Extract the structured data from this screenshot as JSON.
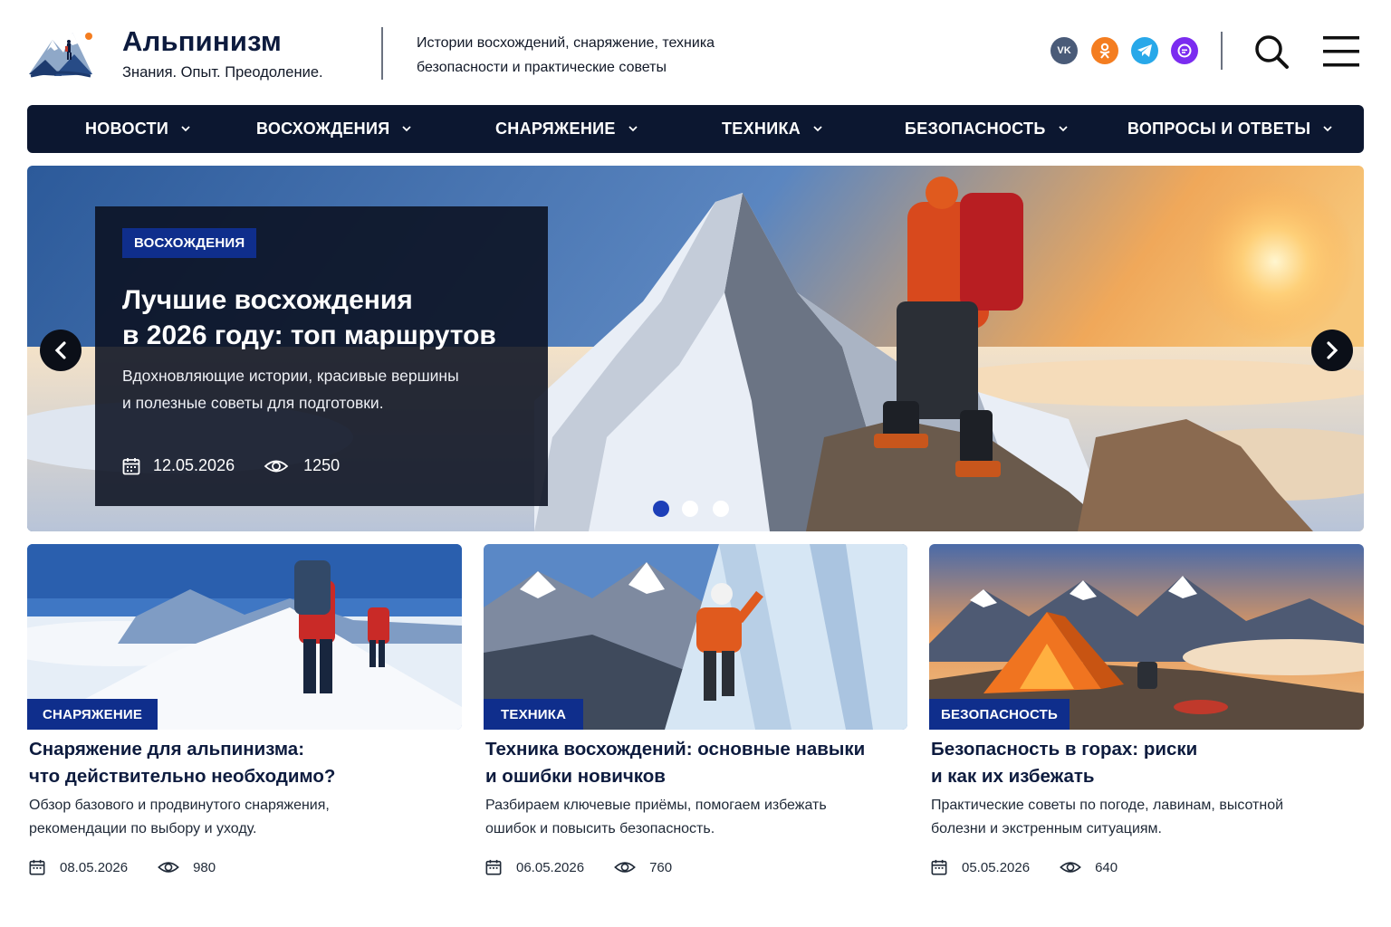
{
  "header": {
    "site_title": "Альпинизм",
    "tagline": "Знания. Опыт. Преодоление.",
    "description_line1": "Истории восхождений, снаряжение, техника",
    "description_line2": "безопасности и практические советы",
    "social": [
      {
        "name": "vk-icon",
        "label": "VK",
        "color": "#4a5b78"
      },
      {
        "name": "odnoklassniki-icon",
        "color": "#f47d20"
      },
      {
        "name": "telegram-icon",
        "color": "#28a8e9"
      },
      {
        "name": "max-messenger-icon",
        "color": "#7b2cf0"
      }
    ],
    "search_icon": "search-icon",
    "menu_icon": "hamburger-menu-icon"
  },
  "nav": {
    "items": [
      {
        "label": "НОВОСТИ"
      },
      {
        "label": "ВОСХОЖДЕНИЯ"
      },
      {
        "label": "СНАРЯЖЕНИЕ"
      },
      {
        "label": "ТЕХНИКА"
      },
      {
        "label": "БЕЗОПАСНОСТЬ"
      },
      {
        "label": "ВОПРОСЫ И ОТВЕТЫ"
      }
    ],
    "dropdown_icon": "chevron-down-icon"
  },
  "hero": {
    "badge": "ВОСХОЖДЕНИЯ",
    "title_line1": "Лучшие восхождения",
    "title_line2": "в 2026 году: топ маршрутов",
    "text_line1": "Вдохновляющие истории, красивые вершины",
    "text_line2": "и полезные советы для подготовки.",
    "date": "12.05.2026",
    "views": "1250",
    "slides_total": 3,
    "active_slide": 1
  },
  "cards": [
    {
      "badge": "СНАРЯЖЕНИЕ",
      "title_line1": "Снаряжение для альпинизма:",
      "title_line2": "что действительно необходимо?",
      "text_line1": "Обзор базового и продвинутого снаряжения,",
      "text_line2": "рекомендации по выбору и уходу.",
      "date": "08.05.2026",
      "views": "980"
    },
    {
      "badge": "ТЕХНИКА",
      "title_line1": "Техника восхождений: основные навыки",
      "title_line2": "и ошибки новичков",
      "text_line1": "Разбираем ключевые приёмы, помогаем избежать",
      "text_line2": "ошибок и повысить безопасность.",
      "date": "06.05.2026",
      "views": "760"
    },
    {
      "badge": "БЕЗОПАСНОСТЬ",
      "title_line1": "Безопасность в горах: риски",
      "title_line2": "и как их избежать",
      "text_line1": "Практические советы по погоде, лавинам, высотной",
      "text_line2": "болезни и экстренным ситуациям.",
      "date": "05.05.2026",
      "views": "640"
    }
  ],
  "colors": {
    "nav_bg": "#0c1730",
    "badge_bg": "#0f2e8c",
    "title_color": "#0d1b3e",
    "active_dot": "#1d3fb8"
  }
}
